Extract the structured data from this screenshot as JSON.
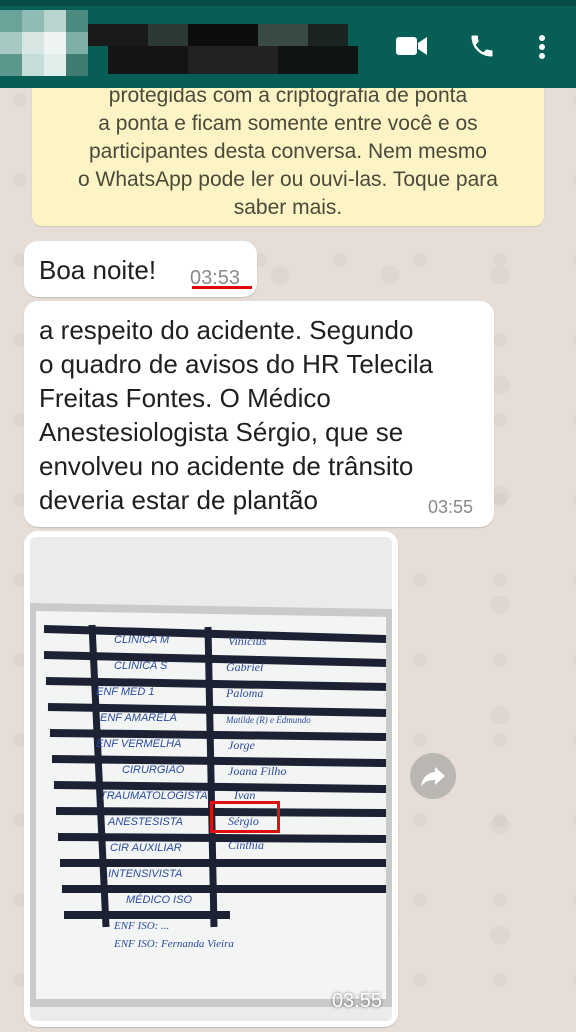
{
  "header": {
    "contact_name": "",
    "icons": [
      "video-call-icon",
      "voice-call-icon",
      "more-options-icon"
    ]
  },
  "notice": {
    "lines": [
      "protegidas com a criptografia de ponta",
      "a ponta e ficam somente entre você e os",
      "participantes desta conversa. Nem mesmo",
      "o WhatsApp pode ler ou ouvi-las. Toque para",
      "saber mais."
    ]
  },
  "messages": [
    {
      "text": "Boa noite!",
      "time": "03:53"
    },
    {
      "lines": [
        "a respeito do acidente. Segundo",
        "o quadro de avisos do HR Telecila",
        "Freitas Fontes. O Médico",
        "Anestesiologista Sérgio, que se",
        "envolveu no acidente de trânsito",
        "deveria estar de plantão"
      ],
      "time": "03:55"
    }
  ],
  "image_message": {
    "time": "03:55",
    "board": {
      "left_column": [
        "CLINICA M",
        "CLINICA S",
        "ENF MED 1",
        "ENF AMARELA",
        "ENF VERMELHA",
        "CIRURGIÃO",
        "TRAUMATOLOGISTA",
        "ANESTESISTA",
        "CIR AUXILIAR",
        "INTENSIVISTA",
        "MÉDICO ISO"
      ],
      "right_column": [
        "Vinícius",
        "Gabriel",
        "Paloma",
        "Matilde (R) e Edmundo",
        "Jorge",
        "Joana Filho",
        "Ivan",
        "Sérgio",
        "Cinthia",
        "",
        ""
      ],
      "footer_lines": [
        "ENF ISO: ...",
        "ENF ISO: Fernanda Vieira"
      ]
    },
    "colors": {
      "highlight": "#e01010",
      "board_ink": "#1c2233",
      "handwriting": "#2a4c9c"
    }
  },
  "colors": {
    "header": "#075e54",
    "notice_bg": "#fdf4c5",
    "time_underline": "#e00000"
  }
}
